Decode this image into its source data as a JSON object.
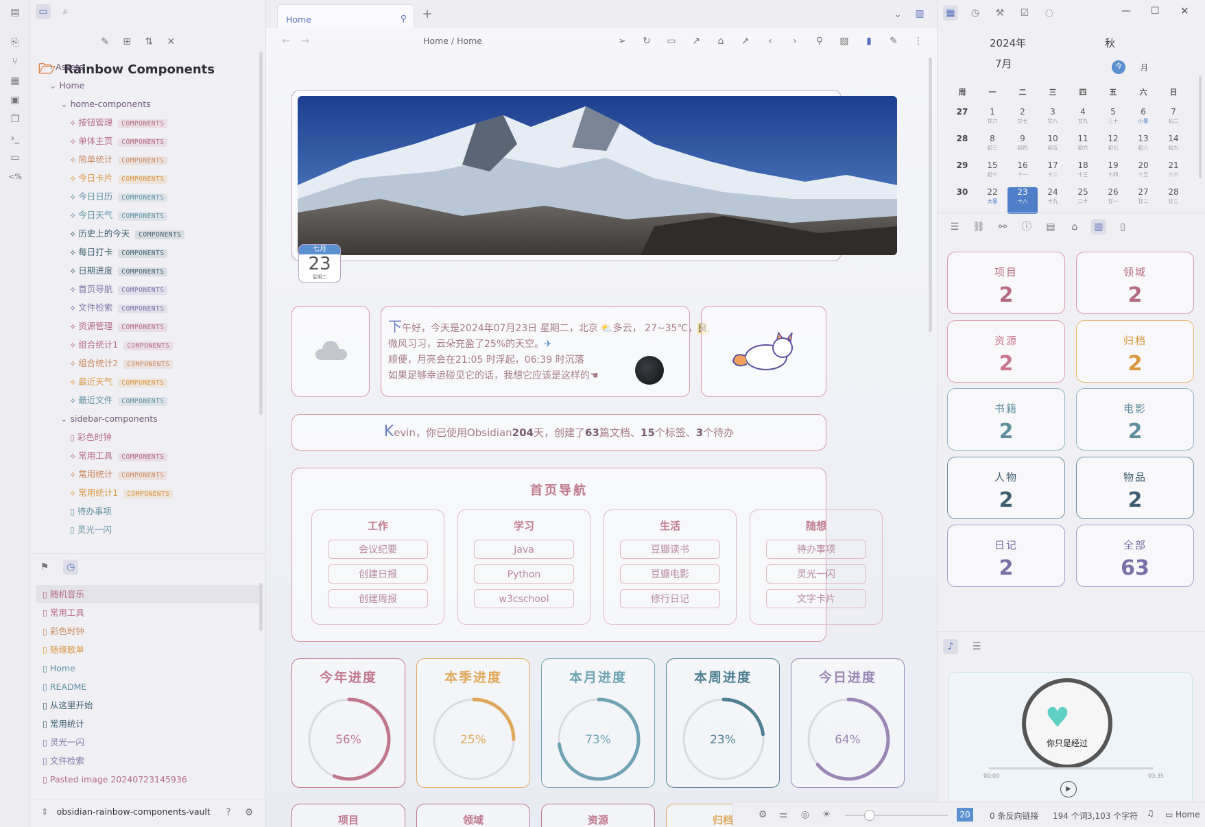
{
  "main": {
    "tab_title": "Home",
    "breadcrumb": "Home / Home",
    "date_badge": {
      "month": "七月",
      "day": "23",
      "weekday": "星期二"
    },
    "greeting": {
      "first_char": "下",
      "line1": "午好，今天是2024年07月23日 星期二，北京 ⛅多云， 27~35℃，",
      "aqi": "良",
      "line2": "微风习习，云朵充盈了25%的天空。",
      "line3": "顺便，月亮会在21:05 时浮起，06:39 时沉落",
      "line4": "如果足够幸运碰见它的话，我想它应该是这样的"
    },
    "summary": {
      "first_char": "K",
      "text_a": "evin，你已使用Obsidian",
      "days": "204",
      "text_b": "天，创建了",
      "docs": "63",
      "text_c": "篇文档、",
      "tags": "15",
      "text_d": "个标签、",
      "todos": "3",
      "text_e": "个待办"
    },
    "home_nav": {
      "title": "首页导航",
      "columns": [
        {
          "title": "工作",
          "items": [
            "会议纪要",
            "创建日报",
            "创建周报"
          ]
        },
        {
          "title": "学习",
          "items": [
            "Java",
            "Python",
            "w3cschool"
          ]
        },
        {
          "title": "生活",
          "items": [
            "豆瓣读书",
            "豆瓣电影",
            "修行日记"
          ]
        },
        {
          "title": "随想",
          "items": [
            "待办事项",
            "灵光一闪",
            "文字卡片"
          ]
        }
      ]
    },
    "progress": [
      {
        "title": "今年进度",
        "value": 56,
        "label": "56%",
        "color": "#c0778e"
      },
      {
        "title": "本季进度",
        "value": 25,
        "label": "25%",
        "color": "#e0a85a"
      },
      {
        "title": "本月进度",
        "value": 73,
        "label": "73%",
        "color": "#6fa3b3"
      },
      {
        "title": "本周进度",
        "value": 23,
        "label": "23%",
        "color": "#4f7f92"
      },
      {
        "title": "今日进度",
        "value": 64,
        "label": "64%",
        "color": "#9a86b5"
      }
    ],
    "bottom_cards": [
      "项目",
      "领域",
      "资源",
      "归档"
    ]
  },
  "left": {
    "vault_title": "Rainbow Components",
    "tree": [
      {
        "label": "Assets",
        "type": "folder-collapsed",
        "depth": 0
      },
      {
        "label": "Home",
        "type": "folder",
        "depth": 0
      },
      {
        "label": "home-components",
        "type": "folder",
        "depth": 1
      },
      {
        "label": "按钮管理",
        "tag": "COMPONENTS",
        "color": "#b46a82",
        "depth": 2
      },
      {
        "label": "单体主页",
        "tag": "COMPONENTS",
        "color": "#b46a82",
        "depth": 2
      },
      {
        "label": "简单统计",
        "tag": "COMPONENTS",
        "color": "#c9875e",
        "depth": 2
      },
      {
        "label": "今日卡片",
        "tag": "COMPONENTS",
        "color": "#d9963e",
        "depth": 2
      },
      {
        "label": "今日日历",
        "tag": "COMPONENTS",
        "color": "#5f8f9f",
        "depth": 2
      },
      {
        "label": "今日天气",
        "tag": "COMPONENTS",
        "color": "#5f8f9f",
        "depth": 2
      },
      {
        "label": "历史上的今天",
        "tag": "COMPONENTS",
        "color": "#3f5f70",
        "depth": 2
      },
      {
        "label": "每日打卡",
        "tag": "COMPONENTS",
        "color": "#3f5f70",
        "depth": 2
      },
      {
        "label": "日期进度",
        "tag": "COMPONENTS",
        "color": "#3f5f70",
        "depth": 2
      },
      {
        "label": "首页导航",
        "tag": "COMPONENTS",
        "color": "#7f73a8",
        "depth": 2
      },
      {
        "label": "文件检索",
        "tag": "COMPONENTS",
        "color": "#7f73a8",
        "depth": 2
      },
      {
        "label": "资源管理",
        "tag": "COMPONENTS",
        "color": "#b46a82",
        "depth": 2
      },
      {
        "label": "组合统计1",
        "tag": "COMPONENTS",
        "color": "#b46a82",
        "depth": 2
      },
      {
        "label": "组合统计2",
        "tag": "COMPONENTS",
        "color": "#c9875e",
        "depth": 2
      },
      {
        "label": "最近天气",
        "tag": "COMPONENTS",
        "color": "#d9963e",
        "depth": 2
      },
      {
        "label": "最近文件",
        "tag": "COMPONENTS",
        "color": "#5f8f9f",
        "depth": 2
      },
      {
        "label": "sidebar-components",
        "type": "folder",
        "depth": 1
      },
      {
        "label": "彩色时钟",
        "type": "file",
        "color": "#b46a82",
        "depth": 2
      },
      {
        "label": "常用工具",
        "tag": "COMPONENTS",
        "color": "#b46a82",
        "depth": 2
      },
      {
        "label": "常用统计",
        "tag": "COMPONENTS",
        "color": "#c9875e",
        "depth": 2
      },
      {
        "label": "常用统计1",
        "tag": "COMPONENTS",
        "color": "#d9963e",
        "depth": 2
      },
      {
        "label": "待办事项",
        "type": "file",
        "color": "#5f8f9f",
        "depth": 2
      },
      {
        "label": "灵光一闪",
        "type": "file",
        "color": "#5f8f9f",
        "depth": 2
      }
    ],
    "recent": [
      "随机音乐",
      "常用工具",
      "彩色时钟",
      "随缘歌单",
      "Home",
      "README",
      "从这里开始",
      "常用统计",
      "灵光一闪",
      "文件检索",
      "Pasted image 20240723145936"
    ],
    "vault_name": "obsidian-rainbow-components-vault"
  },
  "right": {
    "year": "2024年",
    "season": "秋",
    "month": "7月",
    "today_label": "今",
    "month_label": "月",
    "weekday_headers": [
      "周",
      "一",
      "二",
      "三",
      "四",
      "五",
      "六",
      "日"
    ],
    "weeks": [
      {
        "wk": "27",
        "days": [
          [
            "1",
            "廿六"
          ],
          [
            "2",
            "廿七"
          ],
          [
            "3",
            "廿八"
          ],
          [
            "4",
            "廿九"
          ],
          [
            "5",
            "三十"
          ],
          [
            "6",
            "小暑"
          ],
          [
            "7",
            "初二"
          ]
        ]
      },
      {
        "wk": "28",
        "days": [
          [
            "8",
            "初三"
          ],
          [
            "9",
            "初四"
          ],
          [
            "10",
            "初五"
          ],
          [
            "11",
            "初六"
          ],
          [
            "12",
            "初七"
          ],
          [
            "13",
            "初八"
          ],
          [
            "14",
            "初九"
          ]
        ]
      },
      {
        "wk": "29",
        "days": [
          [
            "15",
            "初十"
          ],
          [
            "16",
            "十一"
          ],
          [
            "17",
            "十二"
          ],
          [
            "18",
            "十三"
          ],
          [
            "19",
            "十四"
          ],
          [
            "20",
            "十五"
          ],
          [
            "21",
            "十六"
          ]
        ]
      },
      {
        "wk": "30",
        "days": [
          [
            "22",
            "大暑"
          ],
          [
            "23",
            "十八"
          ],
          [
            "24",
            "十九"
          ],
          [
            "25",
            "二十"
          ],
          [
            "26",
            "廿一"
          ],
          [
            "27",
            "廿二"
          ],
          [
            "28",
            "廿三"
          ]
        ]
      }
    ],
    "stats": [
      {
        "label": "项目",
        "value": "2",
        "color": "#b56a82",
        "border": "#d99aab"
      },
      {
        "label": "领域",
        "value": "2",
        "color": "#b56a82",
        "border": "#d99aab"
      },
      {
        "label": "资源",
        "value": "2",
        "color": "#c9758c",
        "border": "#dba0b0"
      },
      {
        "label": "归档",
        "value": "2",
        "color": "#d9963e",
        "border": "#e6b774"
      },
      {
        "label": "书籍",
        "value": "2",
        "color": "#5f8f9f",
        "border": "#8db5c2"
      },
      {
        "label": "电影",
        "value": "2",
        "color": "#5f8f9f",
        "border": "#8db5c2"
      },
      {
        "label": "人物",
        "value": "2",
        "color": "#3d5d70",
        "border": "#6e8ea0"
      },
      {
        "label": "物品",
        "value": "2",
        "color": "#3d5d70",
        "border": "#6e8ea0"
      },
      {
        "label": "日记",
        "value": "2",
        "color": "#7a6fa6",
        "border": "#a79cc9"
      },
      {
        "label": "全部",
        "value": "63",
        "color": "#7a6fa6",
        "border": "#a79cc9"
      }
    ],
    "music": {
      "caption": "你只是经过",
      "start": "00:00",
      "end": "03:35"
    }
  },
  "status": {
    "zoom": "20",
    "backlinks": "0 条反向链接",
    "words": "194 个词",
    "chars": "3,103 个字符",
    "home": "Home"
  }
}
